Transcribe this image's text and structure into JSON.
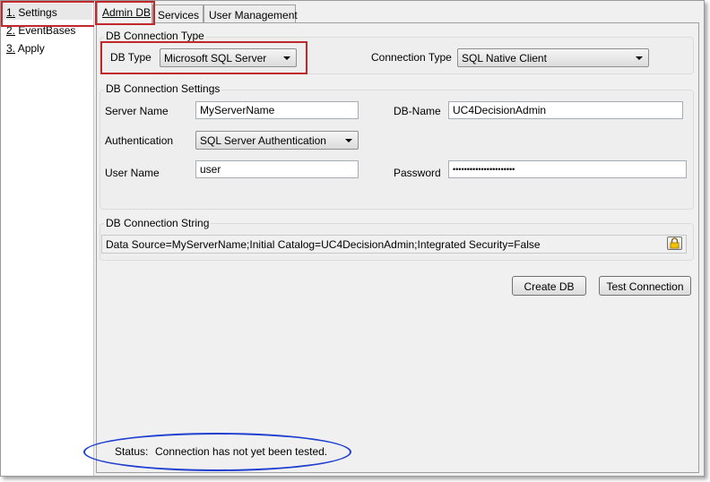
{
  "sidebar": {
    "items": [
      {
        "num": "1.",
        "label": "Settings"
      },
      {
        "num": "2.",
        "label": "EventBases"
      },
      {
        "num": "3.",
        "label": "Apply"
      }
    ]
  },
  "tabs": [
    {
      "label": "Admin DB"
    },
    {
      "label": "Services"
    },
    {
      "label": "User Management"
    }
  ],
  "conn_type_group": {
    "title": "DB Connection Type",
    "db_type_label": "DB Type",
    "db_type_value": "Microsoft SQL Server",
    "connection_type_label": "Connection Type",
    "connection_type_value": "SQL Native Client"
  },
  "conn_settings_group": {
    "title": "DB Connection Settings",
    "server_name_label": "Server Name",
    "server_name_value": "MyServerName",
    "db_name_label": "DB-Name",
    "db_name_value": "UC4DecisionAdmin",
    "authentication_label": "Authentication",
    "authentication_value": "SQL Server Authentication",
    "user_name_label": "User Name",
    "user_name_value": "user",
    "password_label": "Password",
    "password_value": "••••••••••••••••••••••"
  },
  "conn_string_group": {
    "title": "DB Connection String",
    "value": "Data Source=MyServerName;Initial Catalog=UC4DecisionAdmin;Integrated Security=False"
  },
  "buttons": {
    "create_db": "Create DB",
    "test_connection": "Test Connection"
  },
  "status": {
    "label": "Status:",
    "text": "Connection has not yet been tested."
  },
  "annotation_colors": {
    "highlight_box": "#c0282c",
    "status_ellipse": "#1f3fd0"
  },
  "icons": {
    "lock": "lock-icon"
  }
}
